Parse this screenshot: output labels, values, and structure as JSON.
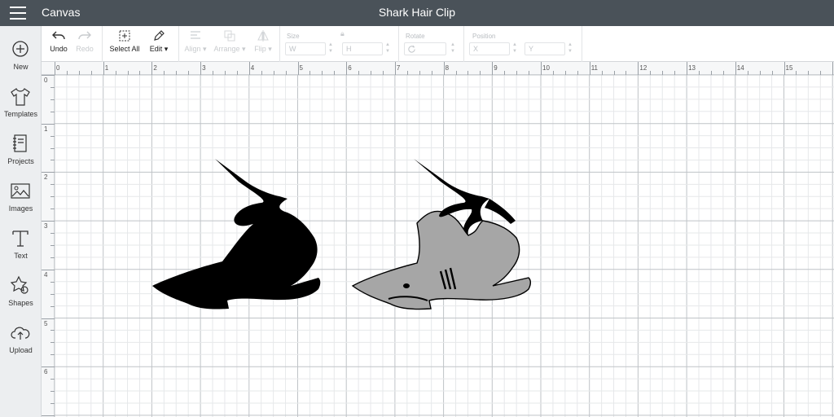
{
  "header": {
    "app_name": "Canvas",
    "doc_title": "Shark Hair Clip",
    "menu_icon": "hamburger-icon"
  },
  "sidebar": {
    "items": [
      {
        "label": "New",
        "icon": "plus-circle-icon"
      },
      {
        "label": "Templates",
        "icon": "shirt-icon"
      },
      {
        "label": "Projects",
        "icon": "notebook-icon"
      },
      {
        "label": "Images",
        "icon": "image-icon"
      },
      {
        "label": "Text",
        "icon": "text-icon"
      },
      {
        "label": "Shapes",
        "icon": "shapes-icon"
      },
      {
        "label": "Upload",
        "icon": "upload-cloud-icon"
      }
    ]
  },
  "toolbar": {
    "undo": "Undo",
    "redo": "Redo",
    "select_all": "Select All",
    "edit": "Edit",
    "align": "Align",
    "arrange": "Arrange",
    "flip": "Flip",
    "size_label": "Size",
    "size_w": "W",
    "size_h": "H",
    "rotate_label": "Rotate",
    "position_label": "Position",
    "pos_x": "X",
    "pos_y": "Y"
  },
  "ruler": {
    "top": [
      "0",
      "1",
      "2",
      "3",
      "4",
      "5",
      "6",
      "7",
      "8",
      "9",
      "10",
      "11",
      "12",
      "13",
      "14",
      "15"
    ],
    "left": [
      "0",
      "1",
      "2",
      "3",
      "4",
      "5",
      "6"
    ]
  },
  "canvas_objects": [
    {
      "name": "shark-silhouette-black",
      "fill": "#000000"
    },
    {
      "name": "shark-detailed-gray",
      "fill": "#a6a6a6"
    }
  ]
}
